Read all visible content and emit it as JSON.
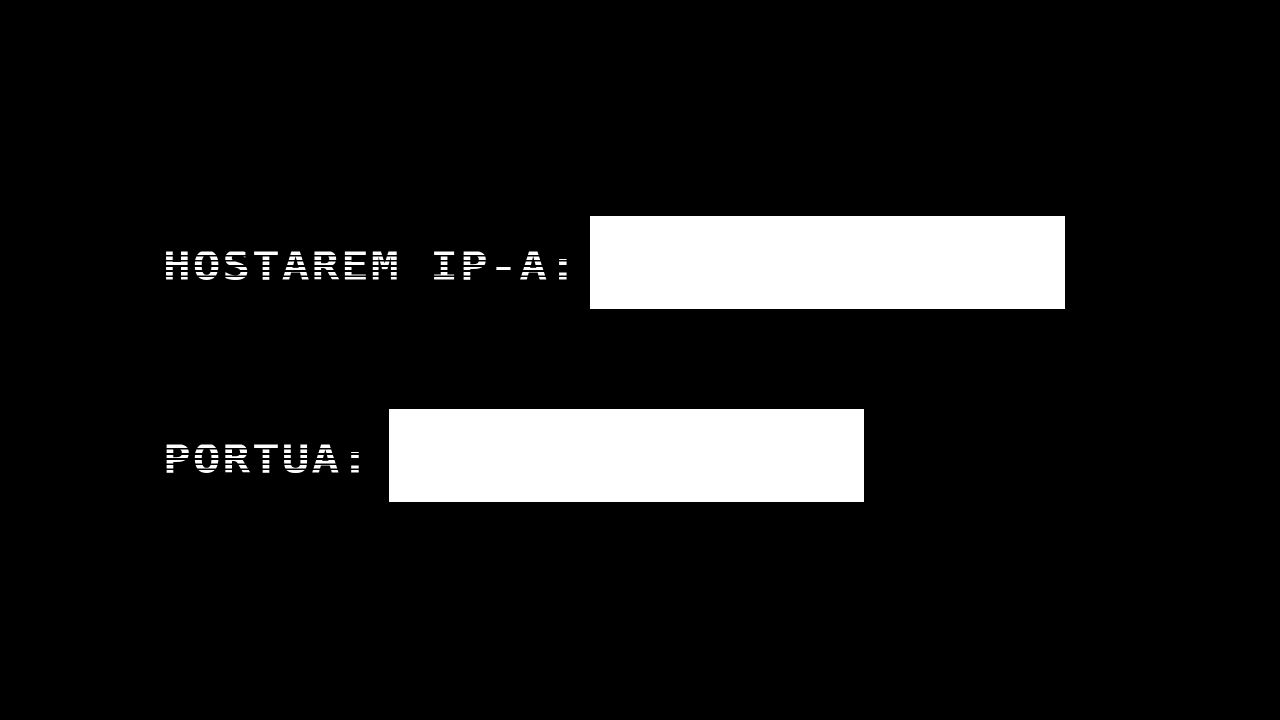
{
  "form": {
    "host_ip": {
      "label": "HOSTAREM IP-A:",
      "value": "",
      "placeholder": ""
    },
    "port": {
      "label": "PORTUA:",
      "value": "",
      "placeholder": ""
    }
  },
  "colors": {
    "background": "#000000",
    "text": "#ffffff",
    "field_background": "#ffffff"
  }
}
